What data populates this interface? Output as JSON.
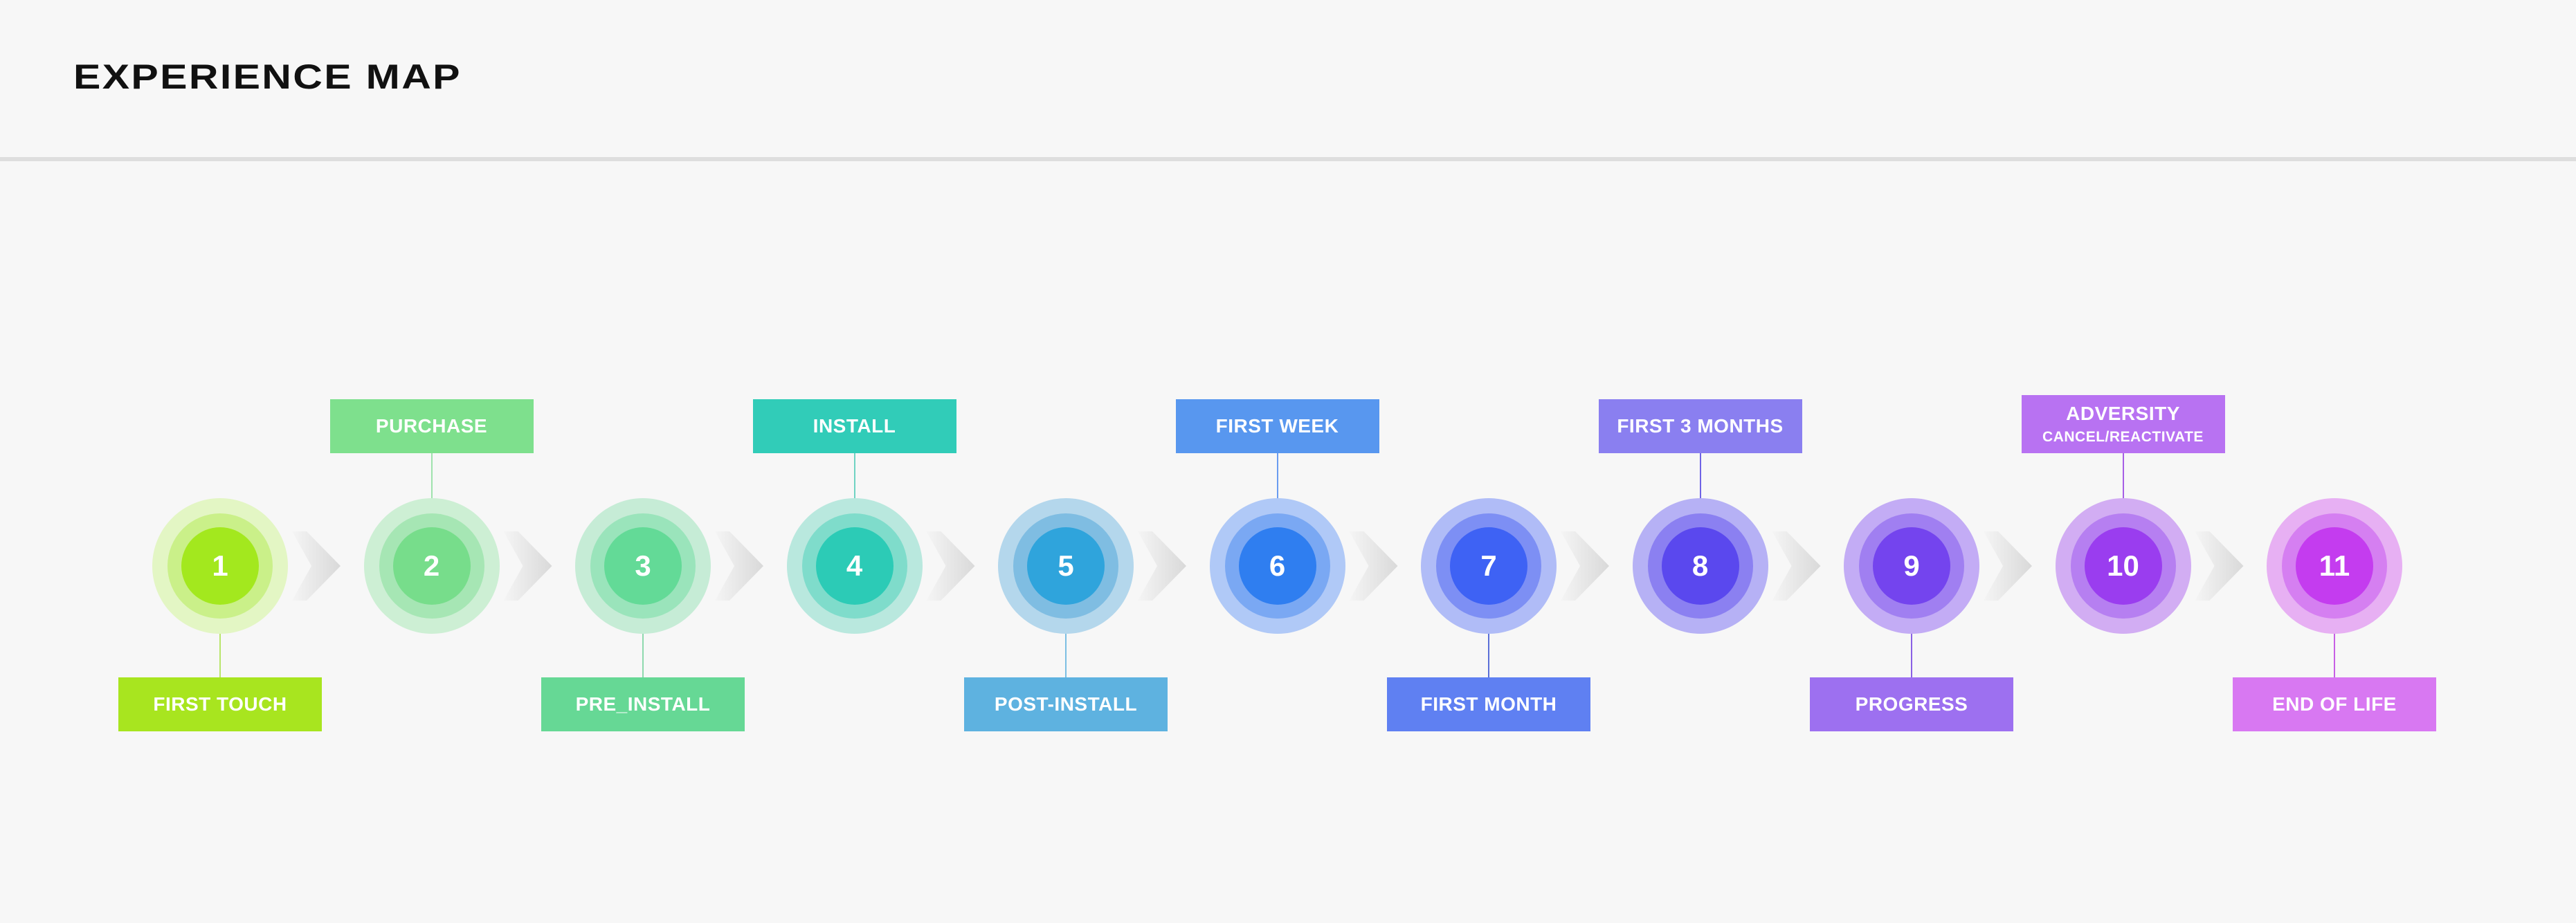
{
  "header": {
    "title": "EXPERIENCE MAP"
  },
  "stages": [
    {
      "number": "1",
      "label": "FIRST TOUCH",
      "sub": "",
      "position": "below",
      "colors": [
        "#e3f6c4",
        "#caf089",
        "#a3e81e"
      ],
      "label_color": "#a8e51f",
      "line_color": "#b8e56a"
    },
    {
      "number": "2",
      "label": "PURCHASE",
      "sub": "",
      "position": "above",
      "colors": [
        "#cdefd4",
        "#a6e6b4",
        "#77dd8b"
      ],
      "label_color": "#7ee08d",
      "line_color": "#9fe2ac"
    },
    {
      "number": "3",
      "label": "PRE_INSTALL",
      "sub": "",
      "position": "below",
      "colors": [
        "#c6ecd6",
        "#9ae4bb",
        "#63da97"
      ],
      "label_color": "#66d895",
      "line_color": "#8ed9ae"
    },
    {
      "number": "4",
      "label": "INSTALL",
      "sub": "",
      "position": "above",
      "colors": [
        "#b9e8de",
        "#7fdccb",
        "#2ccbb6"
      ],
      "label_color": "#31ccb8",
      "line_color": "#6fd3c3"
    },
    {
      "number": "5",
      "label": "POST-INSTALL",
      "sub": "",
      "position": "below",
      "colors": [
        "#b4d7ec",
        "#7fbde2",
        "#2fa4dc"
      ],
      "label_color": "#5eb2e0",
      "line_color": "#7cbfe3"
    },
    {
      "number": "6",
      "label": "FIRST WEEK",
      "sub": "",
      "position": "above",
      "colors": [
        "#b0c9f7",
        "#7aa8f3",
        "#2f7ef0"
      ],
      "label_color": "#5897ef",
      "line_color": "#6a9cf0"
    },
    {
      "number": "7",
      "label": "FIRST MONTH",
      "sub": "",
      "position": "below",
      "colors": [
        "#b0bcf7",
        "#7d8ff4",
        "#3e62f4"
      ],
      "label_color": "#5f80f2",
      "line_color": "#5a6fd8"
    },
    {
      "number": "8",
      "label": "FIRST 3 MONTHS",
      "sub": "",
      "position": "above",
      "colors": [
        "#b6b1f5",
        "#8b80f1",
        "#5a48ee"
      ],
      "label_color": "#8a7ff0",
      "line_color": "#6f63e6"
    },
    {
      "number": "9",
      "label": "PROGRESS",
      "sub": "",
      "position": "below",
      "colors": [
        "#c3acf5",
        "#a07ff1",
        "#7444ee"
      ],
      "label_color": "#9d70f0",
      "line_color": "#8a60e4"
    },
    {
      "number": "10",
      "label": "ADVERSITY",
      "sub": "CANCEL/REACTIVATE",
      "position": "above",
      "colors": [
        "#d2adf3",
        "#b67ff1",
        "#9a3def"
      ],
      "label_color": "#b872f2",
      "line_color": "#a65ee6"
    },
    {
      "number": "11",
      "label": "END OF LIFE",
      "sub": "",
      "position": "below",
      "colors": [
        "#e7b0f3",
        "#d57ff1",
        "#c43cef"
      ],
      "label_color": "#d878f2",
      "line_color": "#c75fe4"
    }
  ]
}
